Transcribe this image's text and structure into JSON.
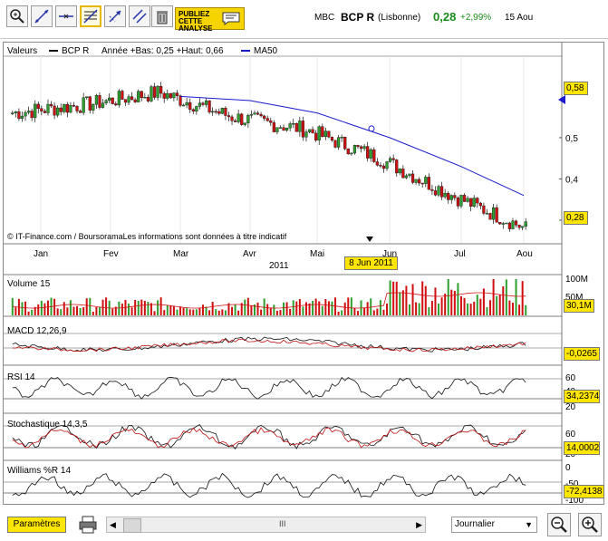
{
  "header": {
    "market": "MBC",
    "ticker": "BCP R",
    "exchange": "(Lisbonne)",
    "price": "0,28",
    "change": "+2,99%",
    "date": "15 Aou",
    "promo_line1": "PUBLIEZ",
    "promo_line2": "CETTE",
    "promo_line3": "ANALYSE"
  },
  "toolbar": {
    "tools": [
      "zoom-in-tool",
      "trendline-tool",
      "horizontal-line-tool",
      "fibonacci-tool",
      "arrow-tool",
      "parallel-lines-tool",
      "trash-tool"
    ]
  },
  "main_panel": {
    "legend_valeurs": "Valeurs",
    "legend_series": "BCP R",
    "legend_range": "Année +Bas: 0,25 +Haut: 0,66",
    "legend_ma": "MA50",
    "attribution": "© IT-Finance.com / BoursoramaLes informations sont données à titre indicatif",
    "price_box": "0,58",
    "last_box": "0,28",
    "cursor_date": "8 Jun 2011",
    "year_label": "2011"
  },
  "volume_panel": {
    "label": "Volume 15",
    "value_box": "30,1M",
    "ticks": [
      "100M",
      "50M"
    ]
  },
  "macd_panel": {
    "label": "MACD 12,26,9",
    "value_box": "-0,0265"
  },
  "rsi_panel": {
    "label": "RSI 14",
    "value_box": "34,2374",
    "ticks": [
      "60",
      "40",
      "20"
    ]
  },
  "stoch_panel": {
    "label": "Stochastique 14,3,5",
    "value_box": "14,0002",
    "ticks": [
      "60",
      "20"
    ]
  },
  "williams_panel": {
    "label": "Williams %R 14",
    "value_box": "-72,4138",
    "ticks": [
      "0",
      "-50",
      "-100"
    ]
  },
  "bottom": {
    "params_label": "Paramètres",
    "scroll_label": "III",
    "period_select": "Journalier"
  },
  "colors": {
    "up": "#2e9e2e",
    "down": "#d01010",
    "ma": "#1a1acc",
    "highlight": "#ffe600"
  },
  "chart_data": {
    "type": "candlestick",
    "title": "BCP R",
    "x_ticks": [
      "Jan",
      "Fev",
      "Mar",
      "Avr",
      "Mai",
      "Jun",
      "Jul",
      "Aou"
    ],
    "y_ticks": [
      0.3,
      0.4,
      0.5
    ],
    "ylim": [
      0.245,
      0.68
    ],
    "price_series_monthly_approx": [
      {
        "month": "Jan",
        "close": 0.56
      },
      {
        "month": "Fev",
        "close": 0.58
      },
      {
        "month": "Mar",
        "close": 0.61
      },
      {
        "month": "Avr",
        "close": 0.55
      },
      {
        "month": "Mai",
        "close": 0.52
      },
      {
        "month": "Jun",
        "close": 0.45
      },
      {
        "month": "Jul",
        "close": 0.36
      },
      {
        "month": "Aou",
        "close": 0.28
      }
    ],
    "ma50_monthly_approx": [
      {
        "month": "Mar",
        "value": 0.6
      },
      {
        "month": "Avr",
        "value": 0.59
      },
      {
        "month": "Mai",
        "value": 0.56
      },
      {
        "month": "Jun",
        "value": 0.5
      },
      {
        "month": "Jul",
        "value": 0.43
      },
      {
        "month": "Aou",
        "value": 0.36
      }
    ],
    "series": [
      {
        "name": "BCP R"
      },
      {
        "name": "MA50"
      }
    ]
  }
}
